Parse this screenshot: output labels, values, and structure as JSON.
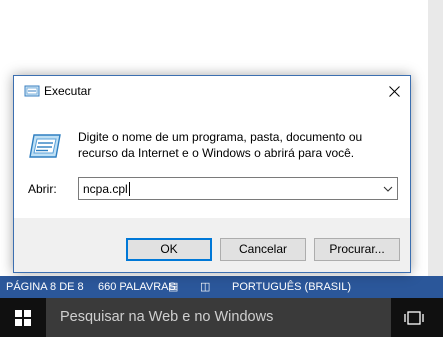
{
  "statusbar": {
    "page": "PÁGINA 8 DE 8",
    "words": "660 PALAVRAS",
    "language": "PORTUGUÊS (BRASIL)"
  },
  "taskbar": {
    "search_placeholder": "Pesquisar na Web e no Windows",
    "start_icon": "windows-logo-icon",
    "taskview_icon": "task-view-icon"
  },
  "dialog": {
    "title": "Executar",
    "description": "Digite o nome de um programa, pasta, documento ou recurso da Internet e o Windows o abrirá para você.",
    "open_label": "Abrir:",
    "open_value": "ncpa.cpl",
    "buttons": {
      "ok": "OK",
      "cancel": "Cancelar",
      "browse": "Procurar..."
    }
  },
  "colors": {
    "statusbar_bg": "#2b579a",
    "taskbar_bg": "#101010",
    "search_bg": "#3a3a3a",
    "dialog_border": "#3c6fb0",
    "default_button_accent": "#0078d7"
  }
}
